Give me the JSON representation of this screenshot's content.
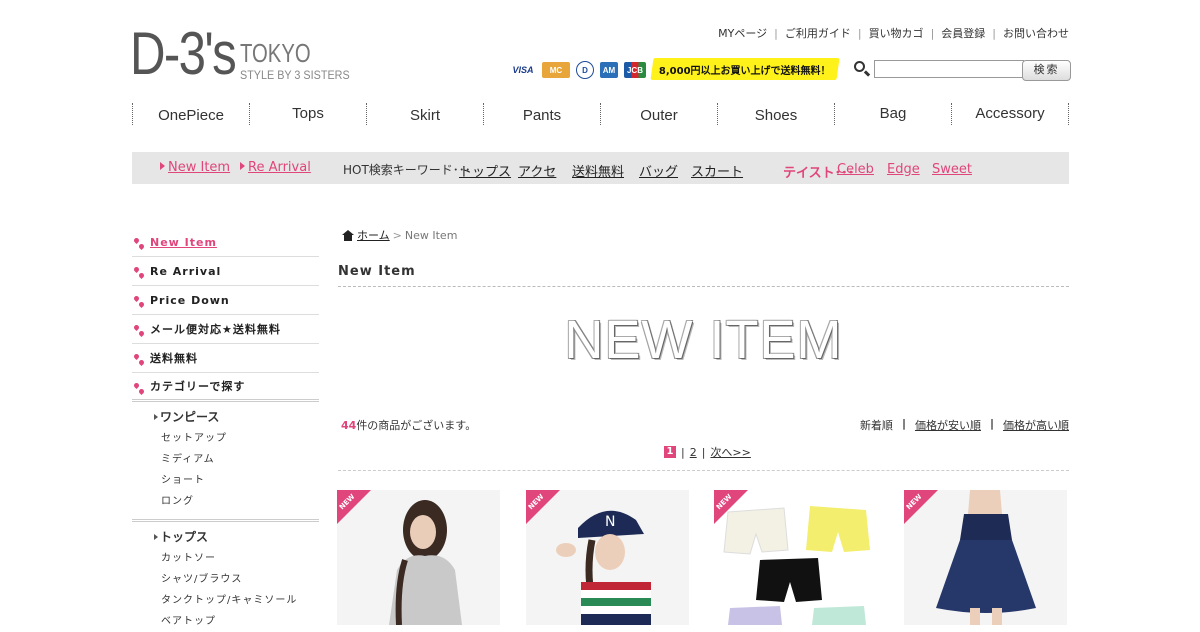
{
  "header": {
    "logo_main": "D-3's",
    "logo_tokyo": "TOKYO",
    "logo_sub": "STYLE BY 3 SISTERS",
    "util_links": [
      "MYページ",
      "ご利用ガイド",
      "買い物カゴ",
      "会員登録",
      "お問い合わせ"
    ],
    "cards": [
      "VISA",
      "MasterCard",
      "Diners",
      "AMEX",
      "JCB"
    ],
    "shipping_banner": "8,000円以上お買い上げで送料無料！",
    "search_placeholder": "",
    "search_button": "検索"
  },
  "main_nav": [
    "OnePiece",
    "Tops",
    "Skirt",
    "Pants",
    "Outer",
    "Shoes",
    "Bag",
    "Accessory"
  ],
  "sub_nav": {
    "new_item": "New Item",
    "re_arrival": "Re Arrival",
    "hot_label": "HOT検索キーワード･･･",
    "keywords": [
      "トップス",
      "アクセ",
      "送料無料",
      "バッグ",
      "スカート"
    ],
    "taste_label": "テイスト･･･",
    "tastes": [
      "Celeb",
      "Edge",
      "Sweet"
    ]
  },
  "sidebar": {
    "items": [
      "New Item",
      "Re Arrival",
      "Price Down",
      "メール便対応★送料無料",
      "送料無料",
      "カテゴリーで探す"
    ],
    "groups": [
      {
        "head": "ワンピース",
        "rows": [
          "セットアップ",
          "ミディアム",
          "ショート",
          "ロング"
        ]
      },
      {
        "head": "トップス",
        "rows": [
          "カットソー",
          "シャツ/ブラウス",
          "タンクトップ/キャミソール",
          "ベアトップ"
        ]
      }
    ]
  },
  "content": {
    "breadcrumb_home": "ホーム",
    "breadcrumb_sep": ">",
    "breadcrumb_current": "New Item",
    "title": "New Item",
    "banner": "NEW ITEM",
    "count_num": "44",
    "count_text": "件の商品がございます。",
    "sort": [
      "新着順",
      "価格が安い順",
      "価格が高い順"
    ],
    "pager": {
      "current": "1",
      "sep": "|",
      "next_page": "2",
      "next": "次へ>>"
    },
    "products": [
      {
        "badge": "NEW",
        "name": "gray-tee-model"
      },
      {
        "badge": "NEW",
        "name": "striped-top-cap-model"
      },
      {
        "badge": "NEW",
        "name": "shorts-set"
      },
      {
        "badge": "NEW",
        "name": "navy-skirt-model"
      }
    ]
  },
  "colors": {
    "accent_pink": "#e0457b",
    "yellow": "#fff21a",
    "subbar_gray": "#e6e6e6"
  }
}
